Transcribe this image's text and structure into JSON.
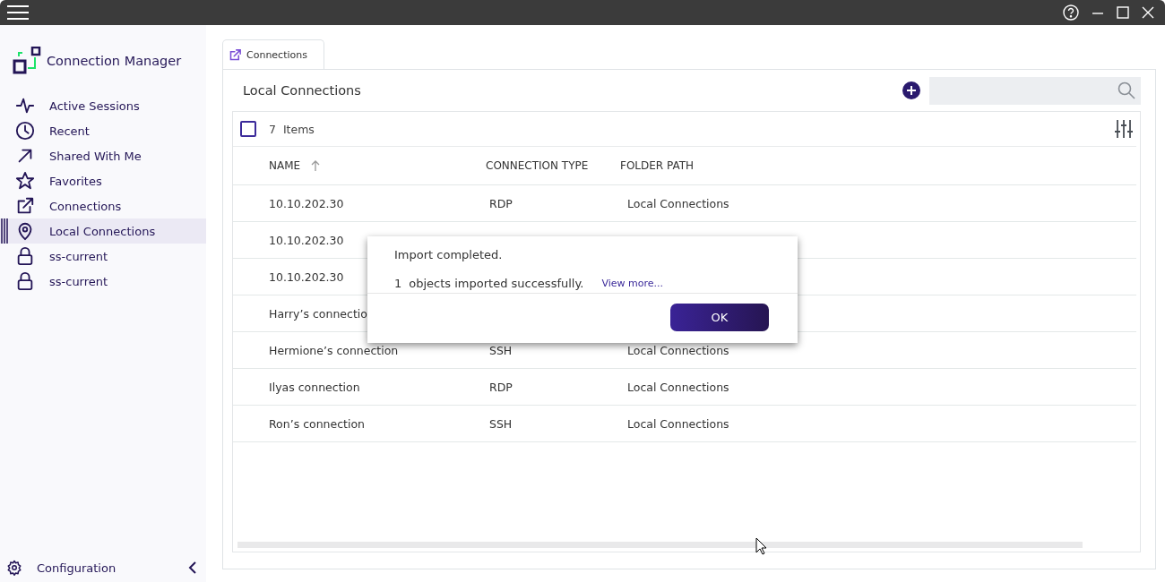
{
  "app": {
    "name": "Connection Manager"
  },
  "sidebar": {
    "items": [
      {
        "label": "Active Sessions",
        "selected": false
      },
      {
        "label": "Recent",
        "selected": false
      },
      {
        "label": "Shared With Me",
        "selected": false
      },
      {
        "label": "Favorites",
        "selected": false
      },
      {
        "label": "Connections",
        "selected": false
      },
      {
        "label": "Local Connections",
        "selected": true
      },
      {
        "label": "ss-current",
        "selected": false
      },
      {
        "label": "ss-current",
        "selected": false
      }
    ],
    "footer": {
      "label": "Configuration"
    }
  },
  "tabs": [
    {
      "label": "Connections",
      "selected": true
    }
  ],
  "panel": {
    "title": "Local Connections"
  },
  "table": {
    "select_all": {
      "checked": false
    },
    "count": "7",
    "count_label": "Items",
    "columns": [
      {
        "label": "NAME",
        "sorted": true
      },
      {
        "label": "CONNECTION TYPE",
        "sorted": false
      },
      {
        "label": "FOLDER PATH",
        "sorted": false
      }
    ],
    "rows": [
      {
        "cells": [
          "10.10.202.30",
          "RDP",
          "Local Connections"
        ]
      },
      {
        "cells": [
          "10.10.202.30"
        ]
      },
      {
        "cells": [
          "10.10.202.30"
        ]
      },
      {
        "cells": [
          "Harry’s connectio"
        ]
      },
      {
        "cells": [
          "Hermione’s connection",
          "SSH",
          "Local Connections"
        ]
      },
      {
        "cells": [
          "Ilyas connection",
          "RDP",
          "Local Connections"
        ]
      },
      {
        "cells": [
          "Ron’s connection",
          "SSH",
          "Local Connections"
        ]
      }
    ]
  },
  "dialog": {
    "title": "Import completed.",
    "count": "1",
    "message": "objects imported successfully.",
    "link": "View more...",
    "button": "OK"
  }
}
